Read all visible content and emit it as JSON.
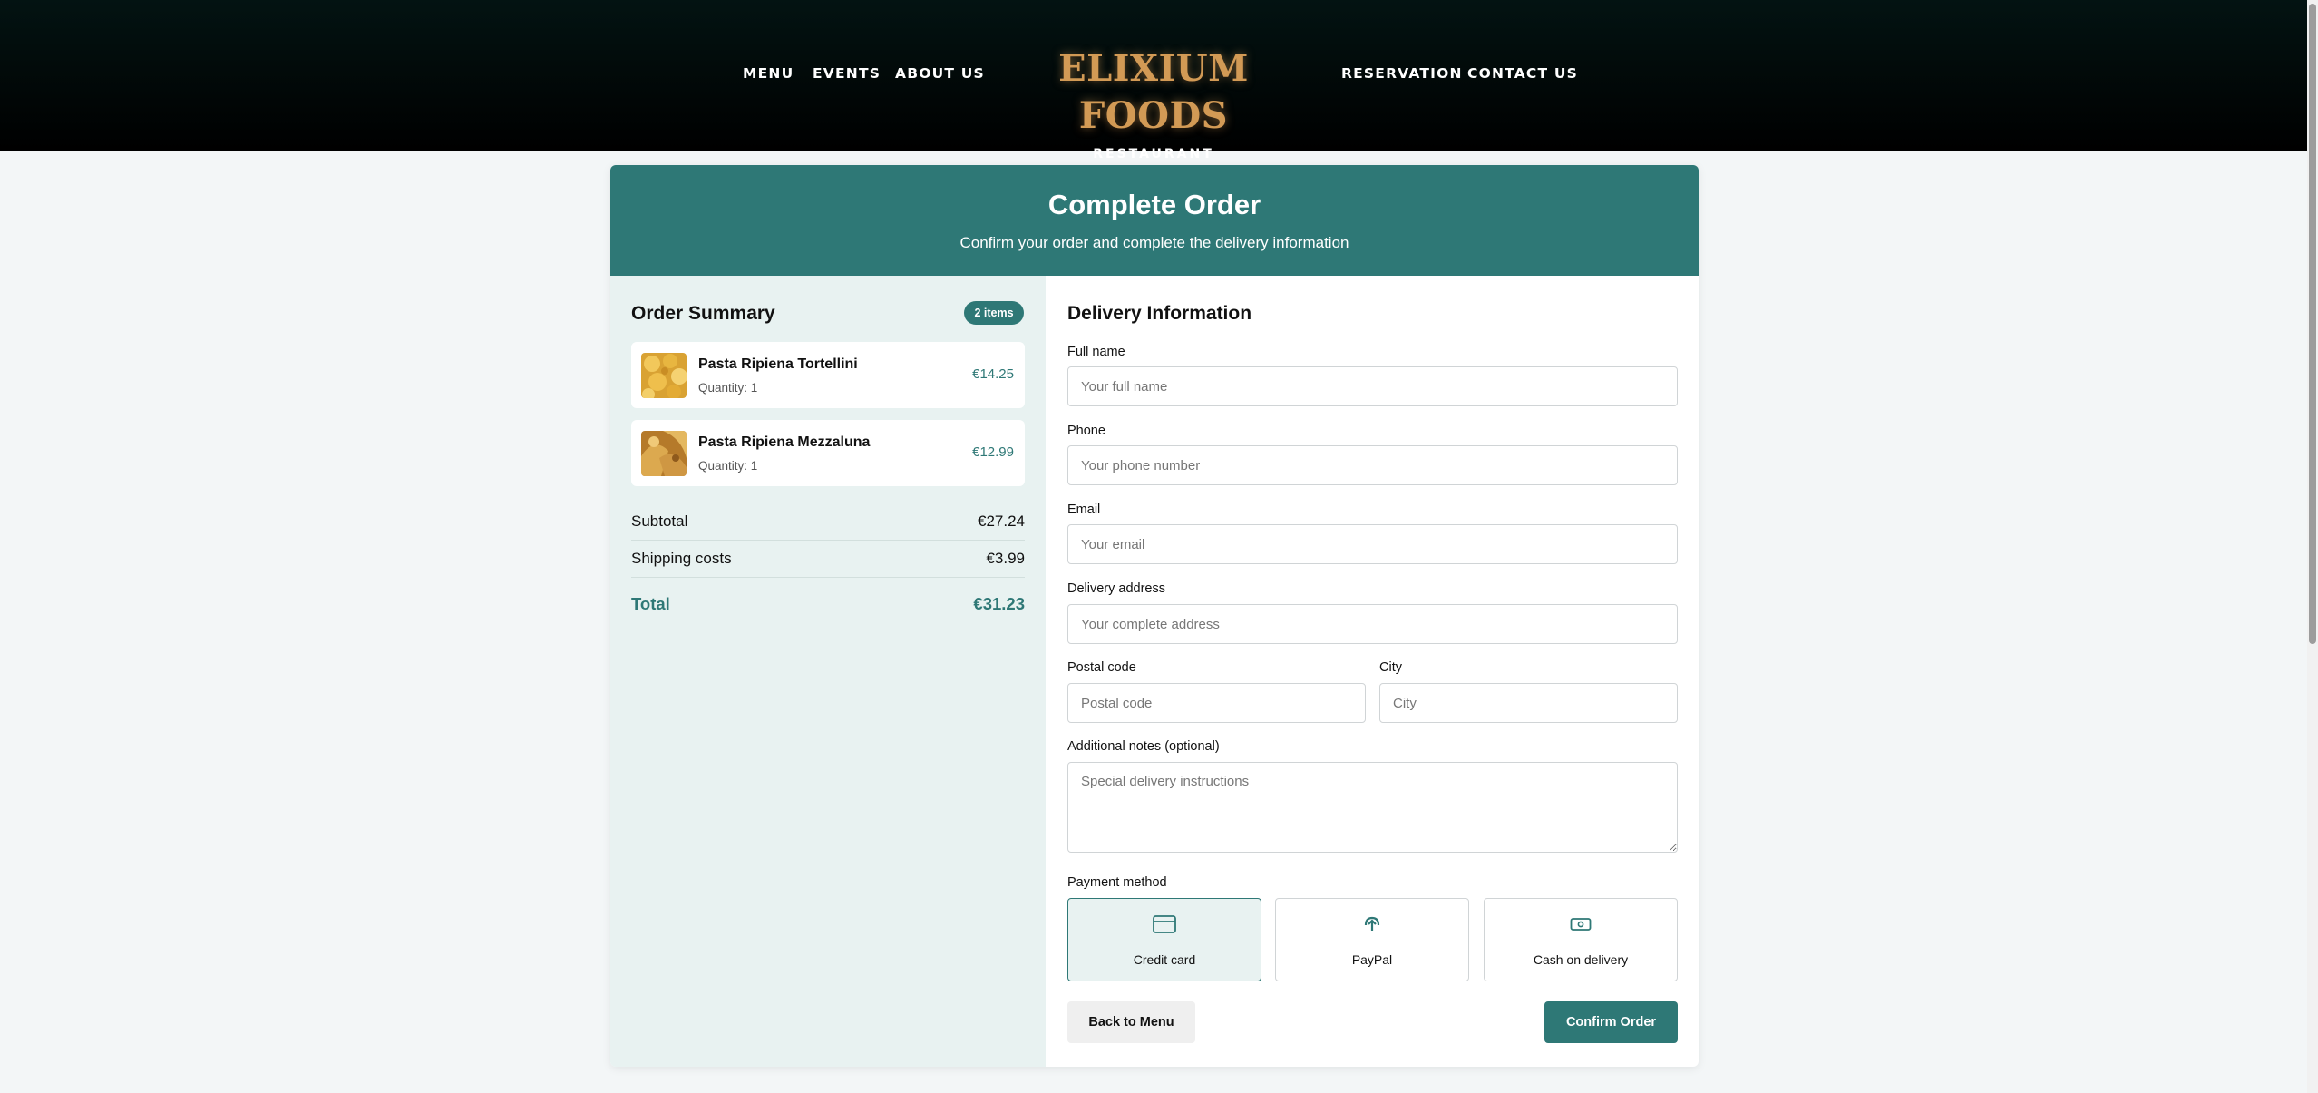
{
  "nav": {
    "left": [
      "MENU",
      "EVENTS",
      "ABOUT US"
    ],
    "right": [
      "RESERVATION",
      "CONTACT US"
    ]
  },
  "brand": {
    "name": "ELIXIUM FOODS",
    "subtitle": "RESTAURANT"
  },
  "page": {
    "title": "Complete Order",
    "subtitle": "Confirm your order and complete the delivery information"
  },
  "summary": {
    "title": "Order Summary",
    "badge": "2 items",
    "items": [
      {
        "name": "Pasta Ripiena Tortellini",
        "quantity": "Quantity: 1",
        "price": "€14.25"
      },
      {
        "name": "Pasta Ripiena Mezzaluna",
        "quantity": "Quantity: 1",
        "price": "€12.99"
      }
    ],
    "subtotal_label": "Subtotal",
    "subtotal": "€27.24",
    "shipping_label": "Shipping costs",
    "shipping": "€3.99",
    "total_label": "Total",
    "total": "€31.23"
  },
  "delivery": {
    "title": "Delivery Information",
    "fields": {
      "full_name": {
        "label": "Full name",
        "placeholder": "Your full name",
        "value": ""
      },
      "phone": {
        "label": "Phone",
        "placeholder": "Your phone number",
        "value": ""
      },
      "email": {
        "label": "Email",
        "placeholder": "Your email",
        "value": ""
      },
      "address": {
        "label": "Delivery address",
        "placeholder": "Your complete address",
        "value": ""
      },
      "postal_code": {
        "label": "Postal code",
        "placeholder": "Postal code",
        "value": ""
      },
      "city": {
        "label": "City",
        "placeholder": "City",
        "value": ""
      },
      "notes": {
        "label": "Additional notes (optional)",
        "placeholder": "Special delivery instructions",
        "value": ""
      }
    },
    "payment": {
      "label": "Payment method",
      "options": [
        {
          "label": "Credit card",
          "icon": "credit-card-icon",
          "selected": true
        },
        {
          "label": "PayPal",
          "icon": "paypal-icon",
          "selected": false
        },
        {
          "label": "Cash on delivery",
          "icon": "cash-icon",
          "selected": false
        }
      ]
    },
    "back_button": "Back to Menu",
    "confirm_button": "Confirm Order"
  },
  "colors": {
    "accent": "#2e7876",
    "accent_light": "#e8f2f1",
    "brand_gold": "#d29a55",
    "header_bg": "#031312"
  }
}
